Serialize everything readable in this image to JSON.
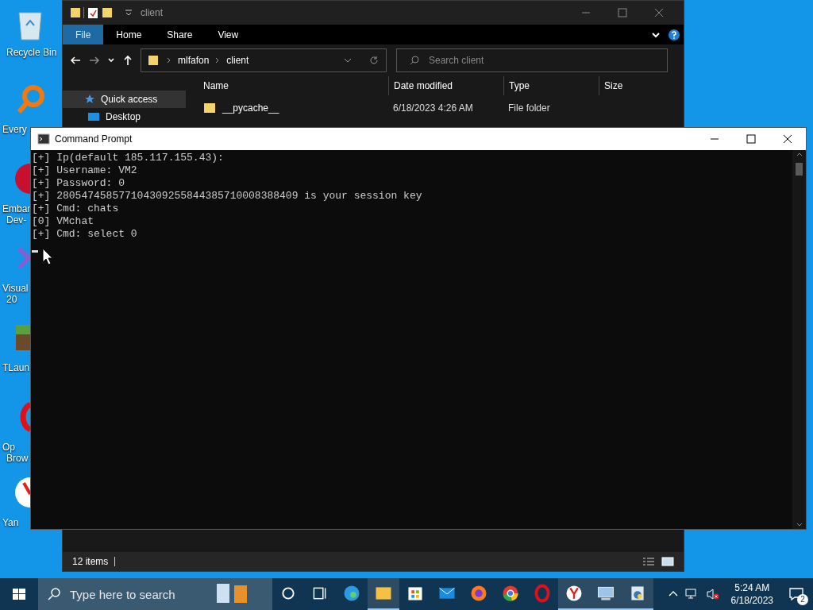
{
  "desktop_icons": [
    {
      "kind": "recycle",
      "lines": [
        "Recycle Bin"
      ]
    },
    {
      "kind": "magnifier",
      "lines": [
        "Every"
      ]
    },
    {
      "kind": "badge",
      "lines": [
        "Embar",
        "Dev-"
      ]
    },
    {
      "kind": "visual",
      "lines": [
        "Visual",
        "20"
      ]
    },
    {
      "kind": "block",
      "lines": [
        "TLaun"
      ]
    },
    {
      "kind": "ring",
      "lines": [
        "Op",
        "Brow"
      ]
    },
    {
      "kind": "y",
      "lines": [
        "Yan"
      ]
    }
  ],
  "explorer": {
    "title": "client",
    "ribbon_tabs": [
      {
        "label": "File",
        "selected": true
      },
      {
        "label": "Home",
        "selected": false
      },
      {
        "label": "Share",
        "selected": false
      },
      {
        "label": "View",
        "selected": false
      }
    ],
    "path": [
      "mlfafon",
      "client"
    ],
    "search": {
      "placeholder": "Search client"
    },
    "nav_items": [
      {
        "label": "Quick access",
        "kind": "star",
        "selected": true
      },
      {
        "label": "Desktop",
        "kind": "desktop",
        "selected": false
      }
    ],
    "columns": [
      "Name",
      "Date modified",
      "Type",
      "Size"
    ],
    "rows": [
      {
        "name": "__pycache__",
        "date": "6/18/2023 4:26 AM",
        "type": "File folder"
      }
    ],
    "status": "12 items"
  },
  "cmd": {
    "title": "Command Prompt",
    "lines": [
      "[+] Ip(default 185.117.155.43):",
      "[+] Username: VM2",
      "[+] Password: 0",
      "[+] 28054745857710430925584438571000838840​9 is your session key",
      "[+] Cmd: chats",
      "[0] VMchat",
      "[+] Cmd: select 0"
    ]
  },
  "taskbar": {
    "search": {
      "placeholder": "Type here to search"
    },
    "apps": [
      {
        "kind": "cortana",
        "active": false
      },
      {
        "kind": "taskview",
        "active": false
      },
      {
        "kind": "edge",
        "active": false
      },
      {
        "kind": "folder",
        "active": true
      },
      {
        "kind": "store",
        "active": false
      },
      {
        "kind": "mail",
        "active": false
      },
      {
        "kind": "firefox",
        "active": false
      },
      {
        "kind": "chrome",
        "active": false
      },
      {
        "kind": "opera",
        "active": false
      },
      {
        "kind": "yandex",
        "active": true
      },
      {
        "kind": "monitor",
        "active": true
      },
      {
        "kind": "python",
        "active": true
      }
    ],
    "time": "5:24 AM",
    "date": "6/18/2023",
    "notifications": "2"
  }
}
